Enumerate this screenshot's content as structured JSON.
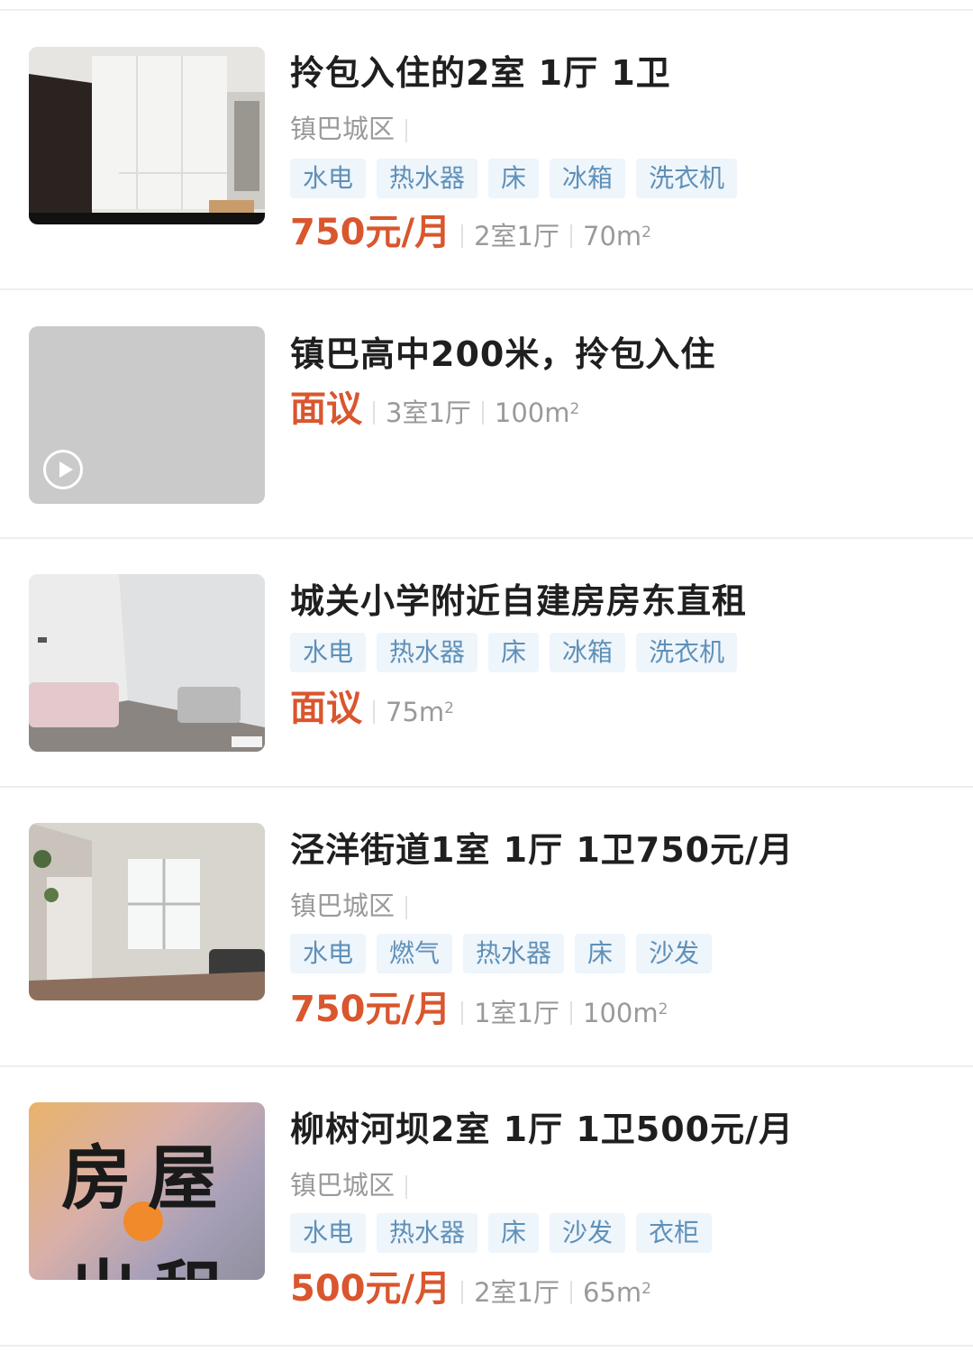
{
  "listings": [
    {
      "title": "拎包入住的2室 1厅 1卫",
      "location": "镇巴城区",
      "tags": [
        "水电",
        "热水器",
        "床",
        "冰箱",
        "洗衣机"
      ],
      "price": "750元/月",
      "layout": "2室1厅",
      "area": "70m",
      "area_sup": "2",
      "thumbnail": "room-wardrobe-photo"
    },
    {
      "title": "镇巴高中200米，拎包入住",
      "price": "面议",
      "layout": "3室1厅",
      "area": "100m",
      "area_sup": "2",
      "thumbnail": "video-placeholder",
      "play_icon": "play-icon"
    },
    {
      "title": "城关小学附近自建房房东直租",
      "tags": [
        "水电",
        "热水器",
        "床",
        "冰箱",
        "洗衣机"
      ],
      "price": "面议",
      "area": "75m",
      "area_sup": "2",
      "thumbnail": "living-room-sofa-photo"
    },
    {
      "title": "泾洋街道1室 1厅 1卫750元/月",
      "location": "镇巴城区",
      "tags": [
        "水电",
        "燃气",
        "热水器",
        "床",
        "沙发"
      ],
      "price": "750元/月",
      "layout": "1室1厅",
      "area": "100m",
      "area_sup": "2",
      "thumbnail": "room-window-photo"
    },
    {
      "title": "柳树河坝2室 1厅 1卫500元/月",
      "location": "镇巴城区",
      "tags": [
        "水电",
        "热水器",
        "床",
        "沙发",
        "衣柜"
      ],
      "price": "500元/月",
      "layout": "2室1厅",
      "area": "65m",
      "area_sup": "2",
      "thumbnail": "for-rent-poster",
      "poster_line1": "房屋",
      "poster_line2": "出租"
    }
  ],
  "colors": {
    "price": "#d9562e",
    "tag_bg": "#eef5fb",
    "tag_text": "#5f90b8",
    "title": "#1f1f1f",
    "meta": "#9a9a9a"
  }
}
